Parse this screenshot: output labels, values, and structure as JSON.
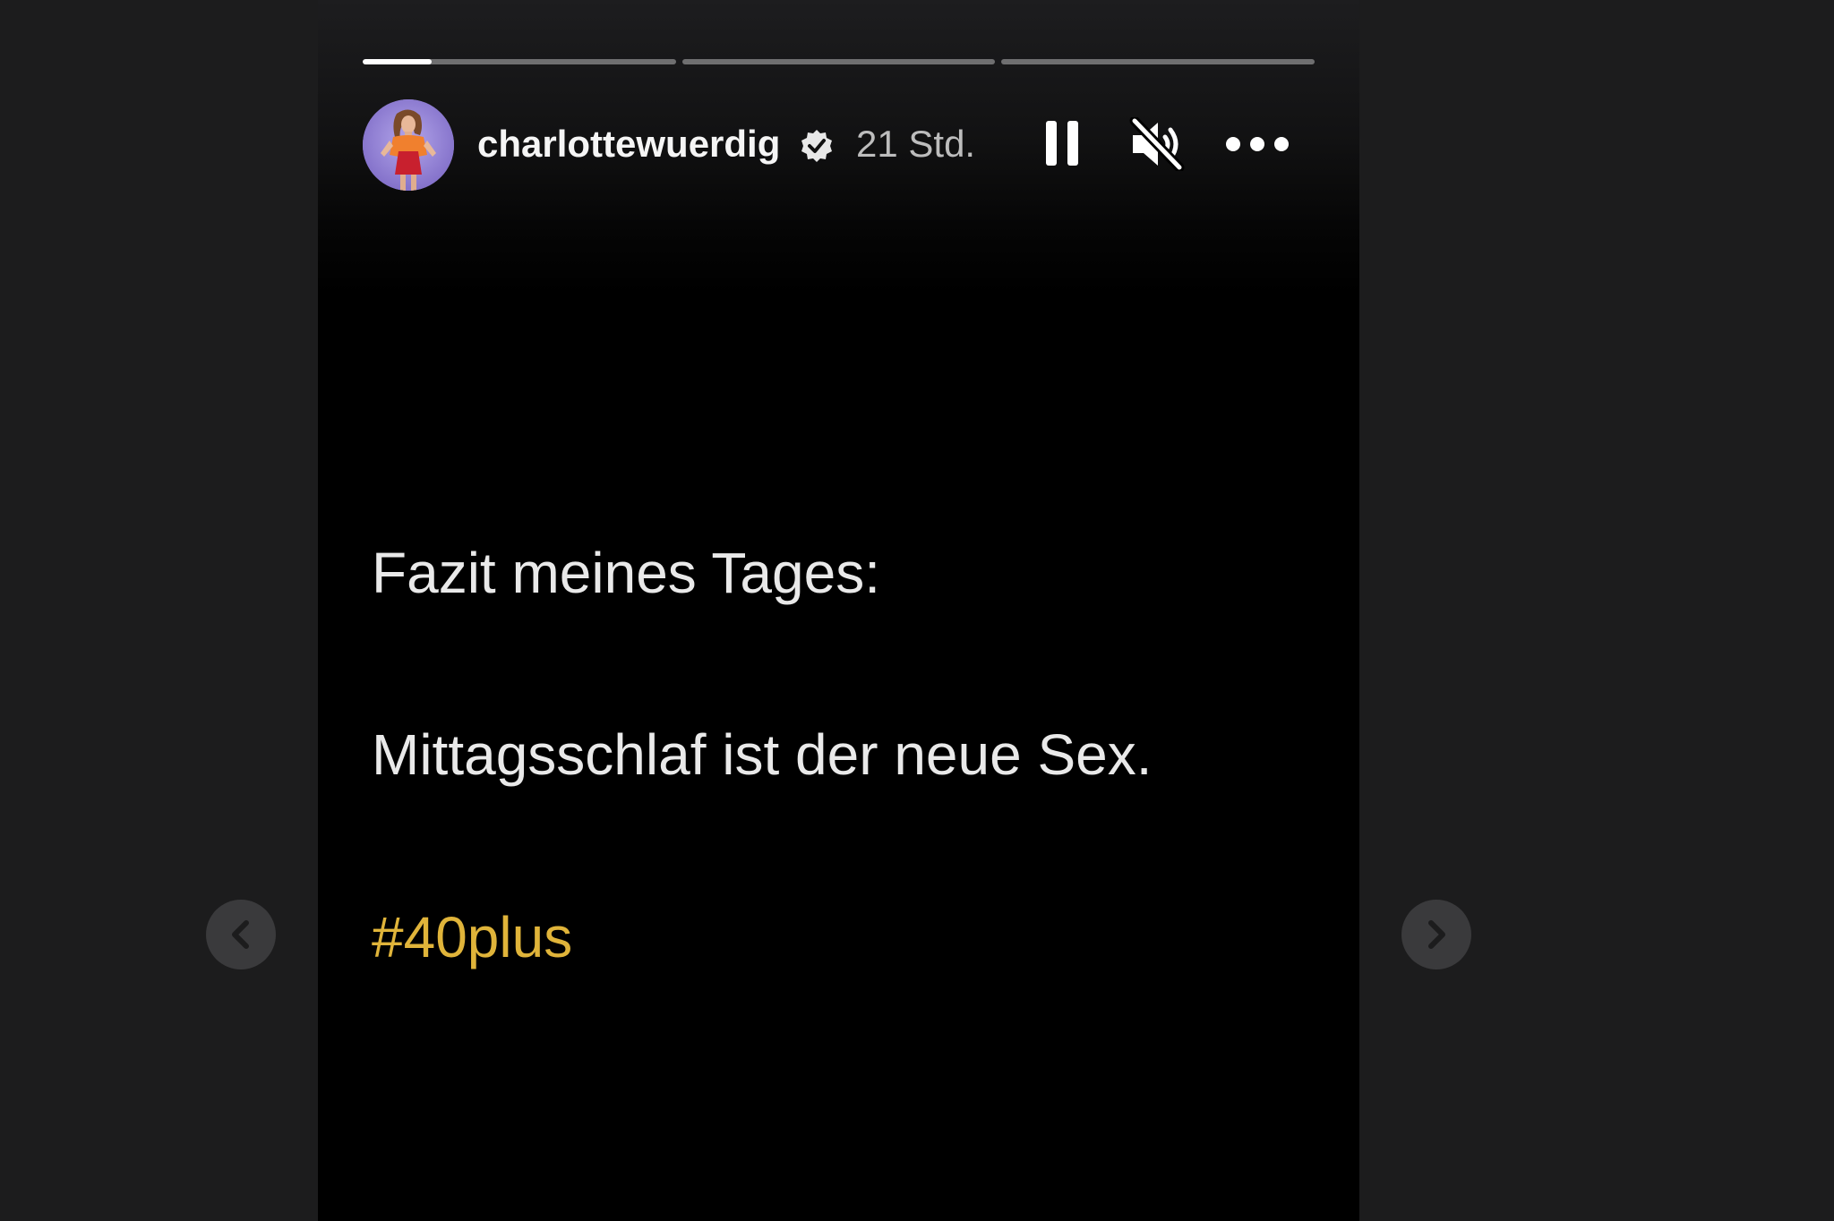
{
  "story": {
    "progress": {
      "segments": 3,
      "active_index": 0,
      "active_fill": 0.22
    },
    "header": {
      "username": "charlottewuerdig",
      "verified": true,
      "time_ago": "21 Std.",
      "controls": [
        "pause-icon",
        "muted-speaker-icon",
        "more-icon"
      ]
    },
    "text": {
      "line1": "Fazit meines Tages:",
      "line2": "Mittagsschlaf ist der neue Sex.",
      "hashtag": "#40plus"
    },
    "colors": {
      "background": "#1c1c1d",
      "story_bg": "#000000",
      "hashtag": "#e0b43a",
      "text": "#e9e9e9"
    }
  },
  "navigation": {
    "prev_icon": "chevron-left-icon",
    "next_icon": "chevron-right-icon"
  }
}
